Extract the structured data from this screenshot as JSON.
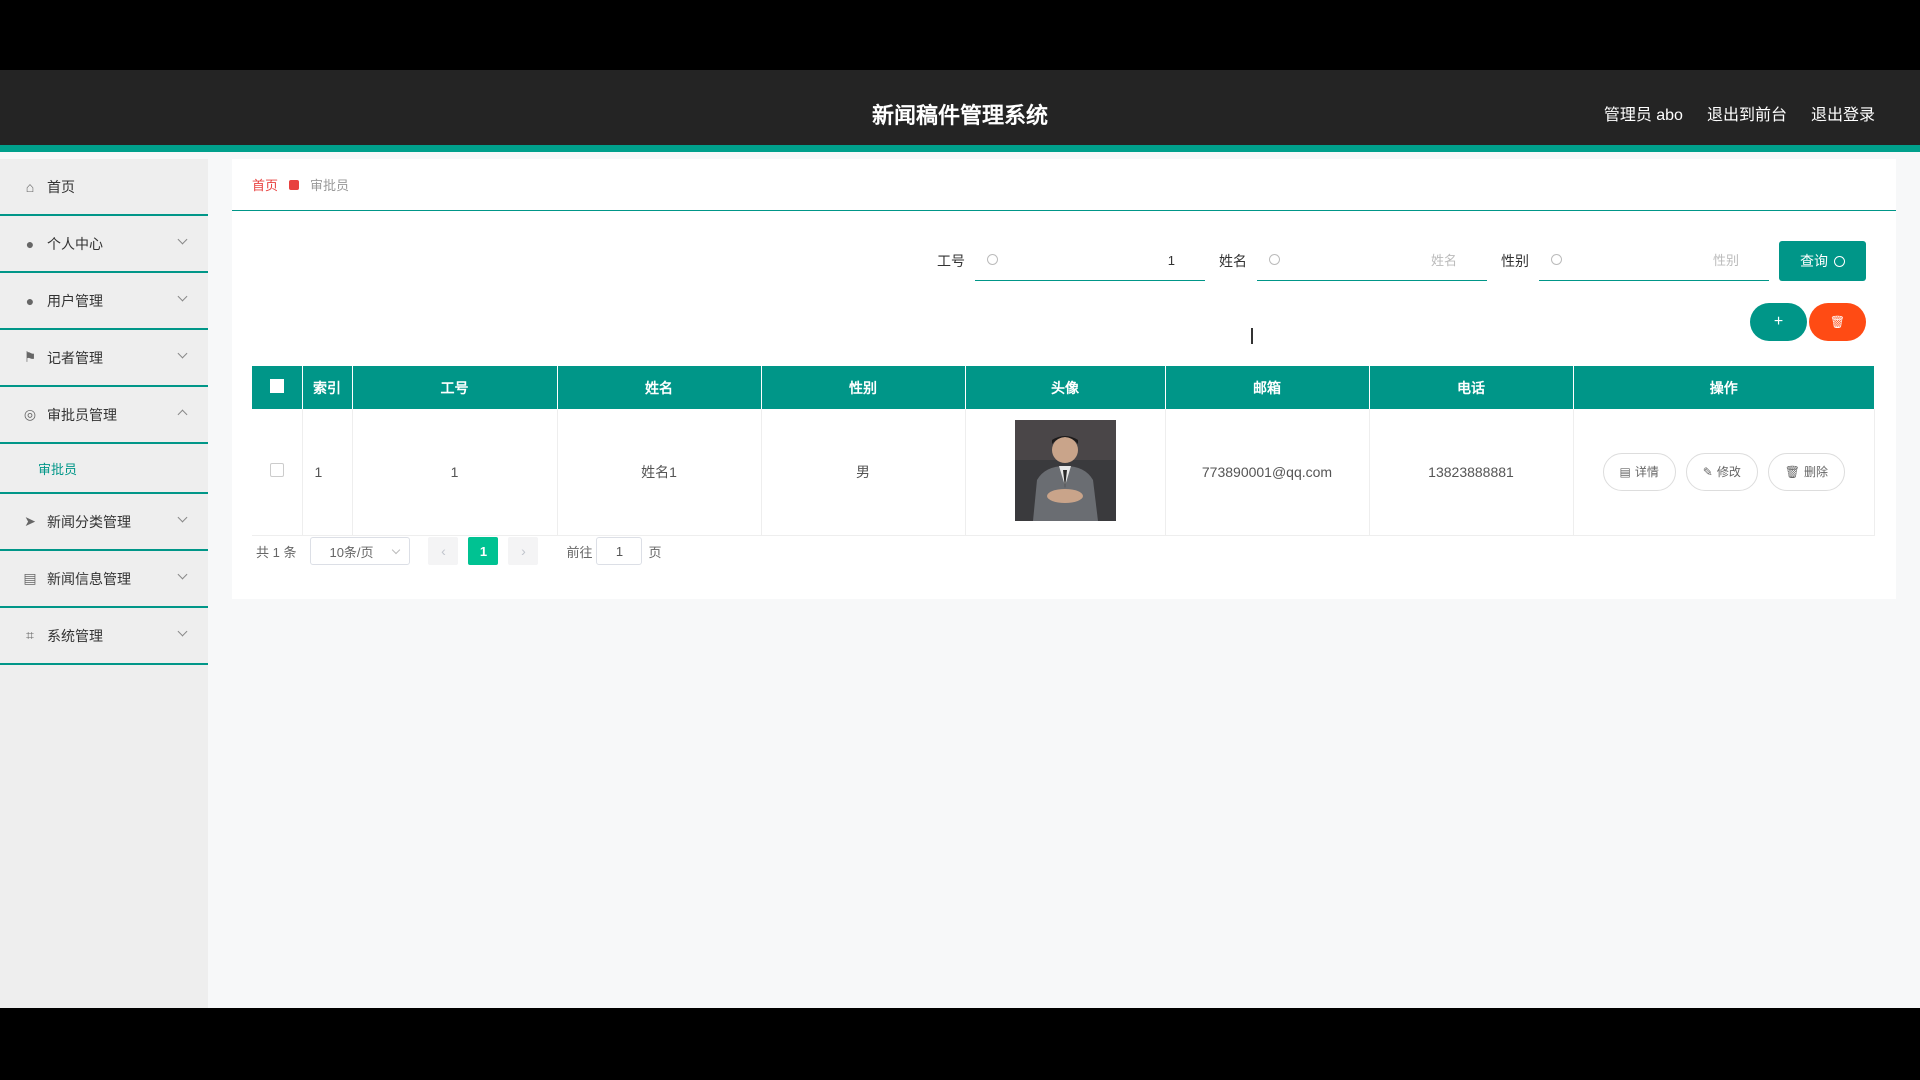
{
  "header": {
    "title": "新闻稿件管理系统",
    "links": [
      "管理员 abo",
      "退出到前台",
      "退出登录"
    ]
  },
  "sidebar": {
    "items": [
      {
        "label": "首页",
        "icon": "home-icon"
      },
      {
        "label": "个人中心",
        "icon": "user-icon"
      },
      {
        "label": "用户管理",
        "icon": "user-icon"
      },
      {
        "label": "记者管理",
        "icon": "flag-icon"
      },
      {
        "label": "审批员管理",
        "icon": "globe-icon"
      },
      {
        "label": "新闻分类管理",
        "icon": "send-icon"
      },
      {
        "label": "新闻信息管理",
        "icon": "chart-icon"
      },
      {
        "label": "系统管理",
        "icon": "crop-icon"
      }
    ],
    "sub_item": "审批员"
  },
  "breadcrumb": {
    "home": "首页",
    "current": "审批员"
  },
  "search": {
    "gonghao_label": "工号",
    "gonghao_value": "1",
    "name_label": "姓名",
    "name_placeholder": "姓名",
    "gender_label": "性别",
    "gender_placeholder": "性别",
    "query_label": "查询"
  },
  "actions": {
    "add": "+",
    "delete": "🗑"
  },
  "table": {
    "headers": [
      "索引",
      "工号",
      "姓名",
      "性别",
      "头像",
      "邮箱",
      "电话",
      "操作"
    ],
    "rows": [
      {
        "index": "1",
        "gonghao": "1",
        "name": "姓名1",
        "gender": "男",
        "email": "773890001@qq.com",
        "phone": "13823888881"
      }
    ],
    "ops": [
      "详情",
      "修改",
      "删除"
    ]
  },
  "pager": {
    "total": "共 1 条",
    "page_size": "10条/页",
    "current": "1",
    "goto_label": "前往",
    "goto_value": "1",
    "page_unit": "页"
  },
  "colors": {
    "accent": "#009688",
    "danger": "#ff4b14",
    "active_page": "#00c292"
  }
}
